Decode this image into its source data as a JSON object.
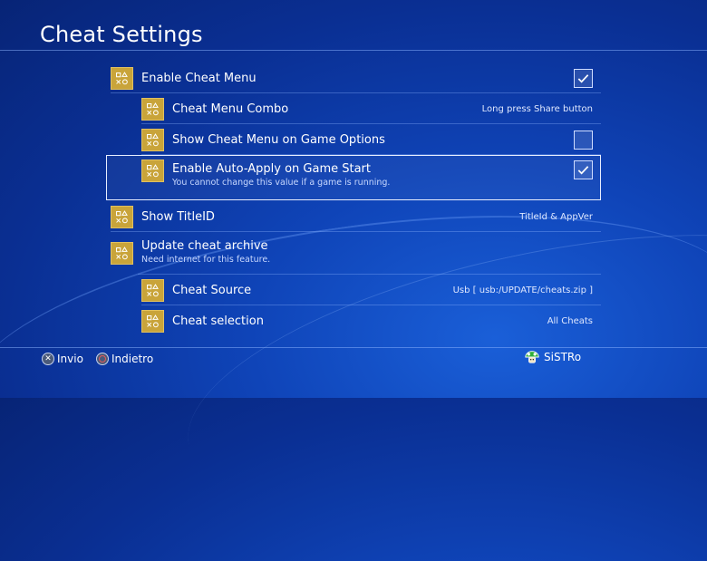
{
  "header": {
    "title": "Cheat Settings"
  },
  "settings": {
    "enable_cheat_menu": {
      "label": "Enable Cheat Menu",
      "checked": true
    },
    "cheat_menu_combo": {
      "label": "Cheat Menu Combo",
      "value": "Long press Share button"
    },
    "show_cheat_menu_game_options": {
      "label": "Show Cheat Menu on Game Options",
      "checked": false
    },
    "enable_auto_apply": {
      "label": "Enable Auto-Apply on Game Start",
      "subtitle": "You cannot change this value if a game is running.",
      "checked": true
    },
    "show_title_id": {
      "label": "Show TitleID",
      "value": "TitleId & AppVer"
    },
    "update_cheat_archive": {
      "label": "Update cheat archive",
      "subtitle": "Need internet for this feature."
    },
    "cheat_source": {
      "label": "Cheat Source",
      "value": "Usb [ usb:/UPDATE/cheats.zip ]"
    },
    "cheat_selection": {
      "label": "Cheat selection",
      "value": "All Cheats"
    }
  },
  "footer": {
    "confirm_label": "Invio",
    "back_label": "Indietro",
    "username": "SiSTRo"
  },
  "icons": {
    "setting_icon": "playstation-shapes-icon",
    "confirm_icon": "cross-button-icon",
    "back_icon": "circle-button-icon",
    "user_avatar": "mushroom-avatar-icon"
  },
  "colors": {
    "icon_gold": "#c9a43a",
    "background": "#0f44b8"
  }
}
